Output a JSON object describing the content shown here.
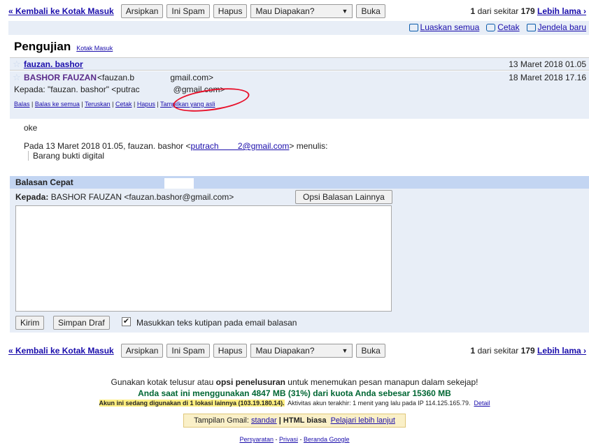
{
  "toolbar": {
    "back_label": "« Kembali ke Kotak Masuk",
    "archive_label": "Arsipkan",
    "spam_label": "Ini Spam",
    "delete_label": "Hapus",
    "more_actions": "Mau Diapakan?",
    "open_label": "Buka",
    "pager": {
      "current": "1",
      "mid": "dari sekitar",
      "total": "179",
      "older_label": "Lebih lama ›"
    }
  },
  "view_tools": {
    "expand_all": "Luaskan semua",
    "print": "Cetak",
    "new_window": "Jendela baru"
  },
  "thread": {
    "subject": "Pengujian",
    "label": "Kotak Masuk"
  },
  "messages": [
    {
      "sender": "fauzan. bashor",
      "date": "13 Maret 2018 01.05"
    },
    {
      "sender": "BASHOR FAUZAN",
      "sender_email": "<fauzan.b     gmail.com>",
      "to_line": "Kepada: \"fauzan. bashor\" <putrac    @gmail.com>",
      "date": "18 Maret 2018 17.16",
      "actions": [
        "Balas",
        "Balas ke semua",
        "Teruskan",
        "Cetak",
        "Hapus",
        "Tampilkan yang asli"
      ],
      "body": "oke",
      "quote_intro": "Pada 13 Maret 2018 01.05, fauzan. bashor <",
      "quote_email": "putrach   2@gmail.com",
      "quote_end": "> menulis:",
      "quote_text": "Barang bukti digital"
    }
  ],
  "quick_reply": {
    "title": "Balasan Cepat",
    "to_label": "Kepada:",
    "to_value": "BASHOR FAUZAN <fauzan.bashor@gmail.com>",
    "options_label": "Opsi Balasan Lainnya",
    "send_label": "Kirim",
    "draft_label": "Simpan Draf",
    "include_quote_label": "Masukkan teks kutipan pada email balasan",
    "include_quote_checked": "✔"
  },
  "footer": {
    "line1_a": "Gunakan kotak telusur atau ",
    "line1_b": "opsi penelusuran",
    "line1_c": " untuk menemukan pesan manapun dalam sekejap!",
    "quota": "Anda saat ini menggunakan 4847 MB (31%) dari kuota Anda sebesar 15360 MB",
    "activity_hl": "Akun ini sedang digunakan di 1 lokasi lainnya (103.19.180.14).",
    "activity": "Aktivitas akun terakhir: 1 menit yang lalu pada IP 114.125.165.79.",
    "detail": "Detail",
    "view_label": "Tampilan Gmail:",
    "view_standard": "standar",
    "view_sep": "|",
    "view_basic": "HTML biasa",
    "learn_more": "Pelajari lebih lanjut",
    "terms": "Persyaratan",
    "privacy": "Privasi",
    "google_home": "Beranda Google",
    "sep": " - "
  }
}
